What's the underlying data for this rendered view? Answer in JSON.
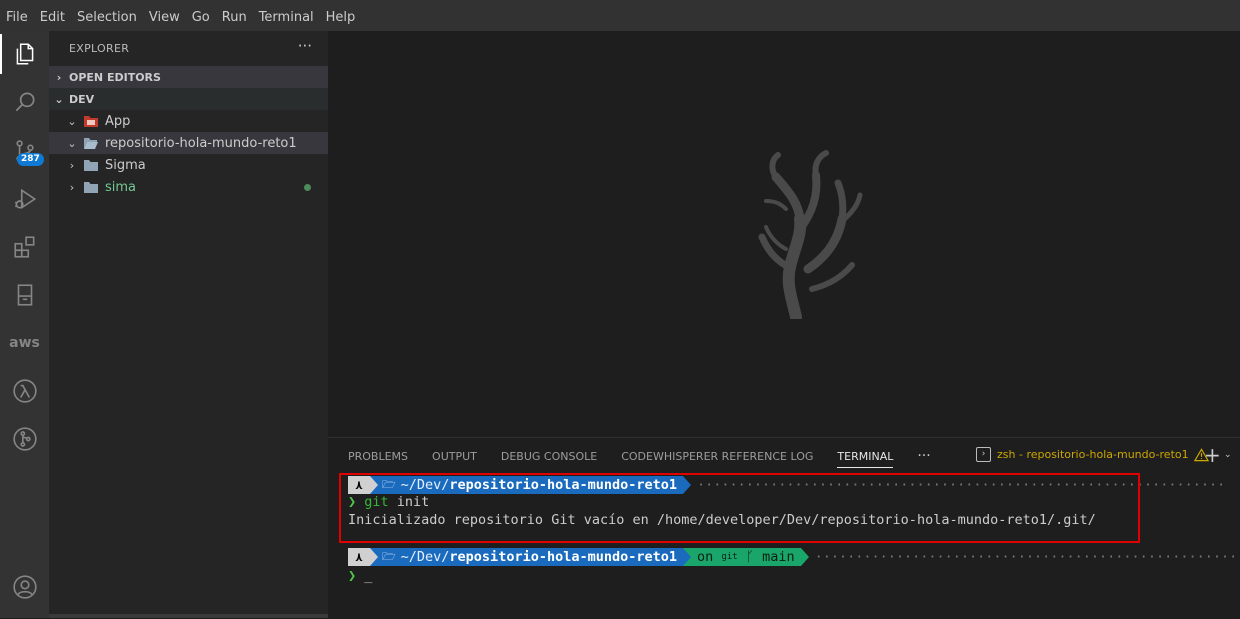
{
  "menu": [
    "File",
    "Edit",
    "Selection",
    "View",
    "Go",
    "Run",
    "Terminal",
    "Help"
  ],
  "activity_bar": {
    "items": [
      {
        "name": "explorer-icon",
        "active": true
      },
      {
        "name": "search-icon"
      },
      {
        "name": "source-control-icon",
        "badge": "287"
      },
      {
        "name": "run-debug-icon"
      },
      {
        "name": "extensions-icon"
      },
      {
        "name": "remote-explorer-icon"
      },
      {
        "name": "aws-icon",
        "label": "aws"
      },
      {
        "name": "lambda-icon",
        "label": "λ"
      },
      {
        "name": "git-graph-icon"
      },
      {
        "name": "account-icon"
      }
    ]
  },
  "sidebar": {
    "title": "EXPLORER",
    "more": "···",
    "sections": {
      "open_editors": "OPEN EDITORS",
      "dev": "DEV"
    },
    "tree": [
      {
        "label": "App",
        "expanded": true,
        "icon": "app-folder-icon",
        "color": "#cccccc"
      },
      {
        "label": "repositorio-hola-mundo-reto1",
        "expanded": true,
        "icon": "folder-open-icon",
        "selected": true,
        "color": "#cccccc"
      },
      {
        "label": "Sigma",
        "expanded": false,
        "icon": "folder-icon",
        "color": "#cccccc"
      },
      {
        "label": "sima",
        "expanded": false,
        "icon": "folder-icon",
        "color": "#73c991",
        "modified": true
      }
    ]
  },
  "panel": {
    "tabs": [
      "PROBLEMS",
      "OUTPUT",
      "DEBUG CONSOLE",
      "CODEWHISPERER REFERENCE LOG",
      "TERMINAL"
    ],
    "active_tab": "TERMINAL",
    "more": "···",
    "terminal_name": "zsh - repositorio-hola-mundo-reto1",
    "plus": "+",
    "dropdown": "⌄"
  },
  "terminal": {
    "prompt1": {
      "os": "⋏",
      "dir_prefix": "~/Dev/",
      "dir_bold": "repositorio-hola-mundo-reto1"
    },
    "line_cmd": {
      "chevron": "❯",
      "cmd": "git",
      "args": " init"
    },
    "line_output": "Inicializado repositorio Git vacío en /home/developer/Dev/repositorio-hola-mundo-reto1/.git/",
    "prompt2": {
      "os": "⋏",
      "dir_prefix": "~/Dev/",
      "dir_bold": "repositorio-hola-mundo-reto1",
      "git_on": "on",
      "git_small": "git",
      "branch_glyph": "ᚴ",
      "branch": "main"
    },
    "line_input": {
      "chevron": "❯",
      "cursor": "_"
    }
  },
  "colors": {
    "accent": "#0e7ad3",
    "highlight_box": "#e00000",
    "prompt_dir": "#1a6bbd",
    "prompt_git": "#1aa56a"
  }
}
